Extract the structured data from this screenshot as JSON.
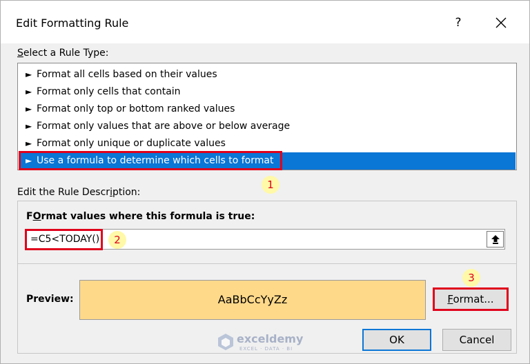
{
  "dialog": {
    "title": "Edit Formatting Rule",
    "help_symbol": "?"
  },
  "rule_type": {
    "label_key": "S",
    "label_rest": "elect a Rule Type:",
    "items": [
      {
        "label": "Format all cells based on their values"
      },
      {
        "label": "Format only cells that contain"
      },
      {
        "label": "Format only top or bottom ranked values"
      },
      {
        "label": "Format only values that are above or below average"
      },
      {
        "label": "Format only unique or duplicate values"
      },
      {
        "label": "Use a formula to determine which cells to format"
      }
    ],
    "selected_index": 5,
    "arrow_glyph": "►"
  },
  "description": {
    "label_pre": "Edit the Rule Descr",
    "label_key": "i",
    "label_post": "ption:",
    "formula_label_key": "O",
    "formula_label_pre": "F",
    "formula_label_post": "rmat values where this formula is true:",
    "formula_value": "=C5<TODAY()",
    "preview_label": "Preview:",
    "preview_text": "AaBbCcYyZz",
    "format_button_key": "F",
    "format_button_rest": "ormat..."
  },
  "buttons": {
    "ok": "OK",
    "cancel": "Cancel"
  },
  "annotations": {
    "badge_1": "1",
    "badge_2": "2",
    "badge_3": "3"
  },
  "watermark": {
    "name": "exceldemy",
    "tagline": "EXCEL · DATA · BI"
  },
  "colors": {
    "selection": "#0a76d6",
    "highlight_box": "#e0001b",
    "badge_bg": "#fff9a8",
    "preview_fill": "#ffd98a"
  }
}
